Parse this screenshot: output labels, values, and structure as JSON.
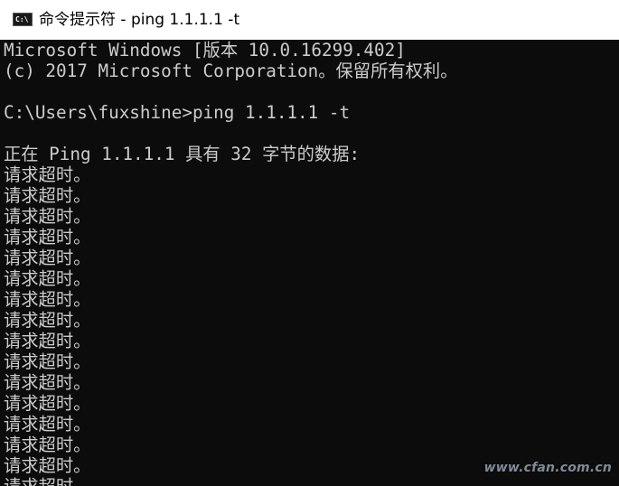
{
  "window": {
    "title": "命令提示符 - ping  1.1.1.1 -t",
    "icon_label": "C:\\"
  },
  "console": {
    "lines": [
      "Microsoft Windows [版本 10.0.16299.402]",
      "(c) 2017 Microsoft Corporation。保留所有权利。",
      "",
      "C:\\Users\\fuxshine>ping 1.1.1.1 -t",
      "",
      "正在 Ping 1.1.1.1 具有 32 字节的数据:",
      "请求超时。",
      "请求超时。",
      "请求超时。",
      "请求超时。",
      "请求超时。",
      "请求超时。",
      "请求超时。",
      "请求超时。",
      "请求超时。",
      "请求超时。",
      "请求超时。",
      "请求超时。",
      "请求超时。",
      "请求超时。",
      "请求超时。",
      "请求超时。"
    ]
  },
  "watermark": "www.cfan.com.cn",
  "colors": {
    "background": "#0c0c0c",
    "text": "#cccccc",
    "titlebar": "#ffffff"
  }
}
